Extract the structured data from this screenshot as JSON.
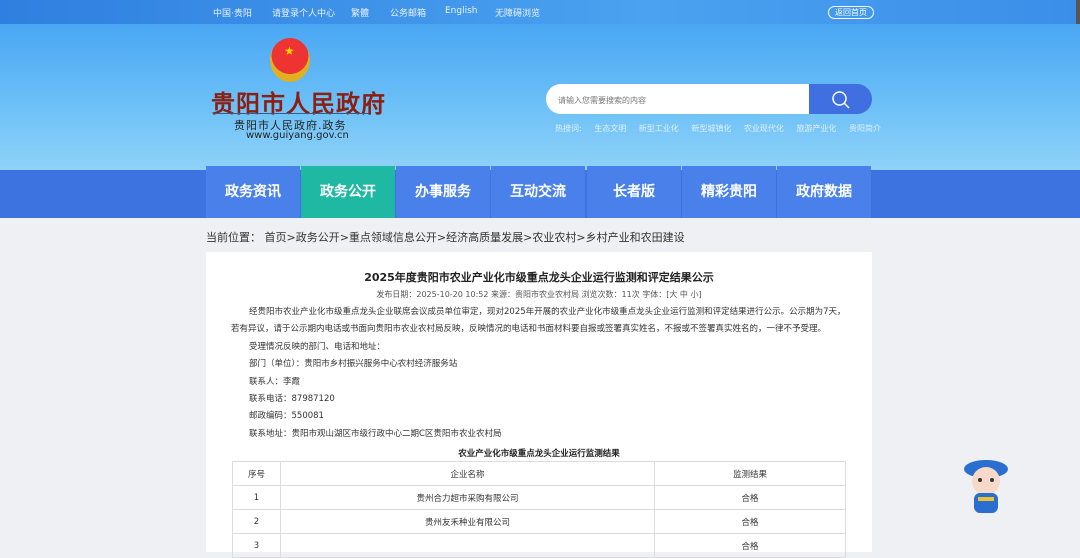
{
  "topbar": {
    "links": [
      "中国·贵阳",
      "请登录个人中心",
      "繁體",
      "公务邮箱",
      "English",
      "无障碍浏览"
    ],
    "home": "返回首页"
  },
  "logo": {
    "title": "贵阳市人民政府",
    "subtitle": "贵阳市人民政府.政务",
    "url": "www.guiyang.gov.cn"
  },
  "search": {
    "placeholder": "请输入您需要搜索的内容",
    "hot_label": "热搜词:",
    "hot": [
      "生态文明",
      "新型工业化",
      "新型城镇化",
      "农业现代化",
      "旅游产业化",
      "贵阳简介"
    ]
  },
  "nav": {
    "items": [
      "政务资讯",
      "政务公开",
      "办事服务",
      "互动交流",
      "长者版",
      "精彩贵阳",
      "政府数据"
    ],
    "active": 1
  },
  "breadcrumb": "当前位置： 首页>政务公开>重点领域信息公开>经济高质量发展>农业农村>乡村产业和农田建设",
  "article": {
    "title": "2025年度贵阳市农业产业化市级重点龙头企业运行监测和评定结果公示",
    "meta": "发布日期：2025-10-20 10:52 来源：贵阳市农业农村局 浏览次数：11次 字体：[大 中 小]",
    "paragraphs": [
      "经贵阳市农业产业化市级重点龙头企业联席会议成员单位审定，现对2025年开展的农业产业化市级重点龙头企业运行监测和评定结果进行公示。公示期为7天，若有异议，请于公示期内电话或书面向贵阳市农业农村局反映，反映情况的电话和书面材料要自报或签署真实姓名，不报或不签署真实姓名的，一律不予受理。",
      "受理情况反映的部门、电话和地址：",
      "部门（单位）：贵阳市乡村振兴服务中心农村经济服务站",
      "联系人：李霞",
      "联系电话：87987120",
      "邮政编码：550081",
      "联系地址：贵阳市观山湖区市级行政中心二期C区贵阳市农业农村局"
    ],
    "table_title": "农业产业化市级重点龙头企业运行监测结果",
    "table": {
      "headers": [
        "序号",
        "企业名称",
        "监测结果"
      ],
      "rows": [
        [
          "1",
          "贵州合力超市采购有限公司",
          "合格"
        ],
        [
          "2",
          "贵州友禾种业有限公司",
          "合格"
        ],
        [
          "3",
          "",
          "合格"
        ]
      ]
    }
  },
  "colors": {
    "nav": "#4a80ea",
    "nav_active": "#1fb8a2",
    "search_button": "#3f6fe0"
  }
}
